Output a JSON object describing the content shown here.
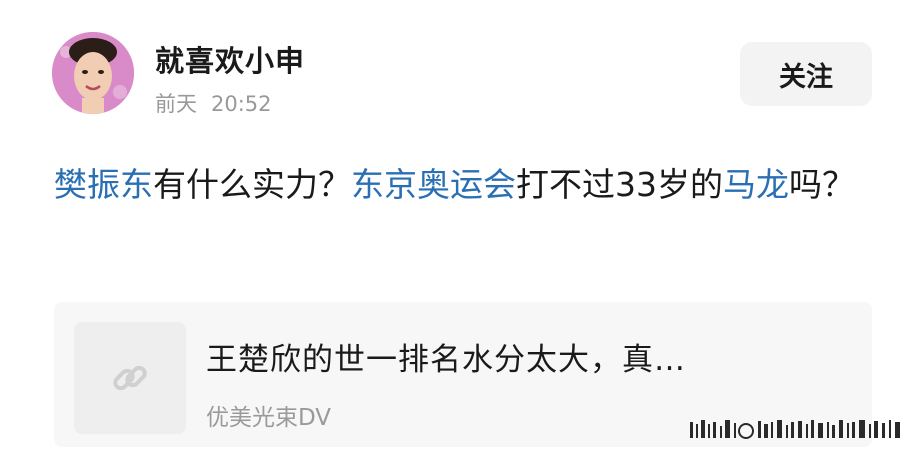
{
  "header": {
    "username": "就喜欢小申",
    "time_day": "前天",
    "time_clock": "20:52",
    "follow_label": "关注"
  },
  "post": {
    "topic_1": "樊振东",
    "text_1": "有什么实力？",
    "topic_2": "东京奥运会",
    "text_2": "打不过33岁的",
    "topic_3": "马龙",
    "text_3": "吗？"
  },
  "link_card": {
    "title": "王楚欣的世一排名水分太大，真…",
    "source": "优美光束DV",
    "icon": "link-icon"
  },
  "colors": {
    "topic": "#2a6fb4",
    "muted": "#999999",
    "card_bg": "#f7f7f7"
  }
}
